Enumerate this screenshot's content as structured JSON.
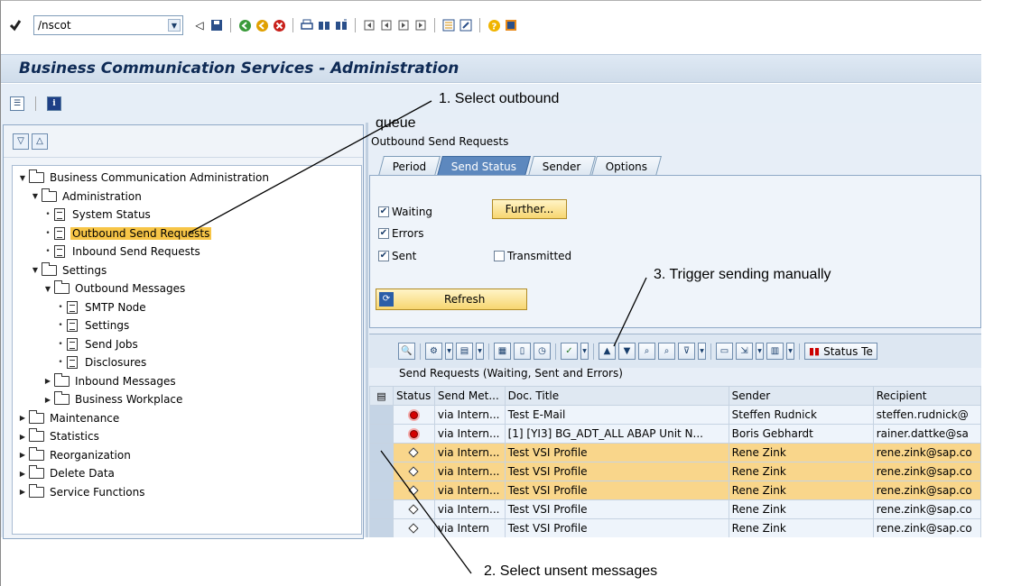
{
  "toolbar": {
    "command_value": "/nscot",
    "icons": [
      "enter-icon",
      "back-icon",
      "save-icon",
      "back-green-icon",
      "exit-icon",
      "cancel-icon",
      "print-icon",
      "find-icon",
      "find-next-icon",
      "first-page-icon",
      "prev-page-icon",
      "next-page-icon",
      "last-page-icon",
      "new-session-icon",
      "shortcut-icon",
      "help-icon",
      "layout-icon"
    ]
  },
  "title": "Business Communication Services - Administration",
  "tree": {
    "items": [
      {
        "label": "Business Communication Administration",
        "type": "folder",
        "expanded": true
      },
      {
        "label": "Administration",
        "type": "folder",
        "expanded": true
      },
      {
        "label": "System Status",
        "type": "doc"
      },
      {
        "label": "Outbound Send Requests",
        "type": "doc",
        "selected": true
      },
      {
        "label": "Inbound Send Requests",
        "type": "doc"
      },
      {
        "label": "Settings",
        "type": "folder",
        "expanded": true
      },
      {
        "label": "Outbound Messages",
        "type": "folder",
        "expanded": true
      },
      {
        "label": "SMTP Node",
        "type": "doc"
      },
      {
        "label": "Settings",
        "type": "doc"
      },
      {
        "label": "Send Jobs",
        "type": "doc"
      },
      {
        "label": "Disclosures",
        "type": "doc"
      },
      {
        "label": "Inbound Messages",
        "type": "folder",
        "expanded": false
      },
      {
        "label": "Business Workplace",
        "type": "folder",
        "expanded": false
      },
      {
        "label": "Maintenance",
        "type": "folder",
        "expanded": false
      },
      {
        "label": "Statistics",
        "type": "folder",
        "expanded": false
      },
      {
        "label": "Reorganization",
        "type": "folder",
        "expanded": false
      },
      {
        "label": "Delete Data",
        "type": "folder",
        "expanded": false
      },
      {
        "label": "Service Functions",
        "type": "folder",
        "expanded": false
      }
    ]
  },
  "right": {
    "section_title": "Outbound Send Requests",
    "tabs": [
      "Period",
      "Send Status",
      "Sender",
      "Options"
    ],
    "active_tab": "Send Status",
    "checkboxes": {
      "waiting": {
        "label": "Waiting",
        "checked": true
      },
      "errors": {
        "label": "Errors",
        "checked": true
      },
      "sent": {
        "label": "Sent",
        "checked": true
      },
      "transmitted": {
        "label": "Transmitted",
        "checked": false
      }
    },
    "further_label": "Further...",
    "refresh_label": "Refresh",
    "status_button_label": "Status Te",
    "grid_title": "Send Requests (Waiting, Sent and Errors)",
    "columns": [
      "Status",
      "Send Met...",
      "Doc. Title",
      "Sender",
      "Recipient"
    ],
    "rows": [
      {
        "status": "error",
        "method": "via Intern...",
        "title": "Test E-Mail",
        "sender": "Steffen Rudnick",
        "recipient": "steffen.rudnick@",
        "highlight": false
      },
      {
        "status": "error",
        "method": "via Intern...",
        "title": "[1] [YI3] BG_ADT_ALL ABAP Unit N...",
        "sender": "Boris Gebhardt",
        "recipient": "rainer.dattke@sa",
        "highlight": false
      },
      {
        "status": "waiting",
        "method": "via Intern...",
        "title": "Test VSI Profile",
        "sender": "Rene Zink",
        "recipient": "rene.zink@sap.co",
        "highlight": true
      },
      {
        "status": "waiting",
        "method": "via Intern...",
        "title": "Test VSI Profile",
        "sender": "Rene Zink",
        "recipient": "rene.zink@sap.co",
        "highlight": true
      },
      {
        "status": "waiting",
        "method": "via Intern...",
        "title": "Test VSI Profile",
        "sender": "Rene Zink",
        "recipient": "rene.zink@sap.co",
        "highlight": true
      },
      {
        "status": "waiting",
        "method": "via Intern...",
        "title": "Test VSI Profile",
        "sender": "Rene Zink",
        "recipient": "rene.zink@sap.co",
        "highlight": false
      },
      {
        "status": "waiting",
        "method": "via Intern",
        "title": "Test VSI Profile",
        "sender": "Rene Zink",
        "recipient": "rene.zink@sap.co",
        "highlight": false
      }
    ]
  },
  "annotations": {
    "a1": "1. Select outbound",
    "a1b": "queue",
    "a2": "2. Select unsent messages",
    "a3": "3. Trigger sending manually"
  },
  "colors": {
    "selection_yellow": "#f7c547",
    "row_highlight": "#f9d68b",
    "title_text": "#0e2a55",
    "panel_bg": "#e7eef7"
  }
}
